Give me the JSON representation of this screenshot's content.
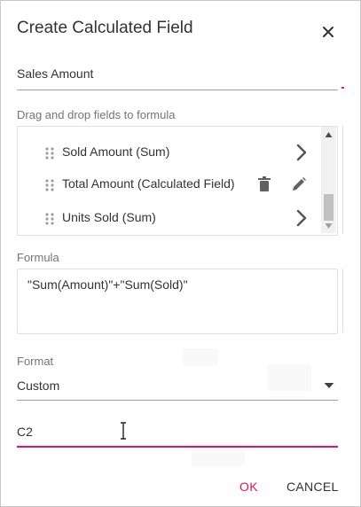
{
  "dialog": {
    "title": "Create Calculated Field",
    "close_icon": "close-icon"
  },
  "name_field": {
    "value": "Sales Amount"
  },
  "fields_section": {
    "label": "Drag and drop fields to formula",
    "items": [
      {
        "label": "Sold Amount (Sum)",
        "action_icon": "chevron-right-icon"
      },
      {
        "label": "Total Amount (Calculated Field)",
        "action_icons": [
          "trash-icon",
          "pencil-icon"
        ]
      },
      {
        "label": "Units Sold (Sum)",
        "action_icon": "chevron-right-icon"
      }
    ]
  },
  "formula_section": {
    "label": "Formula",
    "value": "\"Sum(Amount)\"+\"Sum(Sold)\""
  },
  "format_section": {
    "label": "Format",
    "selected": "Custom"
  },
  "custom_format": {
    "value": "C2"
  },
  "buttons": {
    "ok": "OK",
    "cancel": "CANCEL"
  },
  "colors": {
    "accent": "#e3165b",
    "text": "#333333",
    "label": "#757575",
    "border": "#e0e0e0"
  }
}
